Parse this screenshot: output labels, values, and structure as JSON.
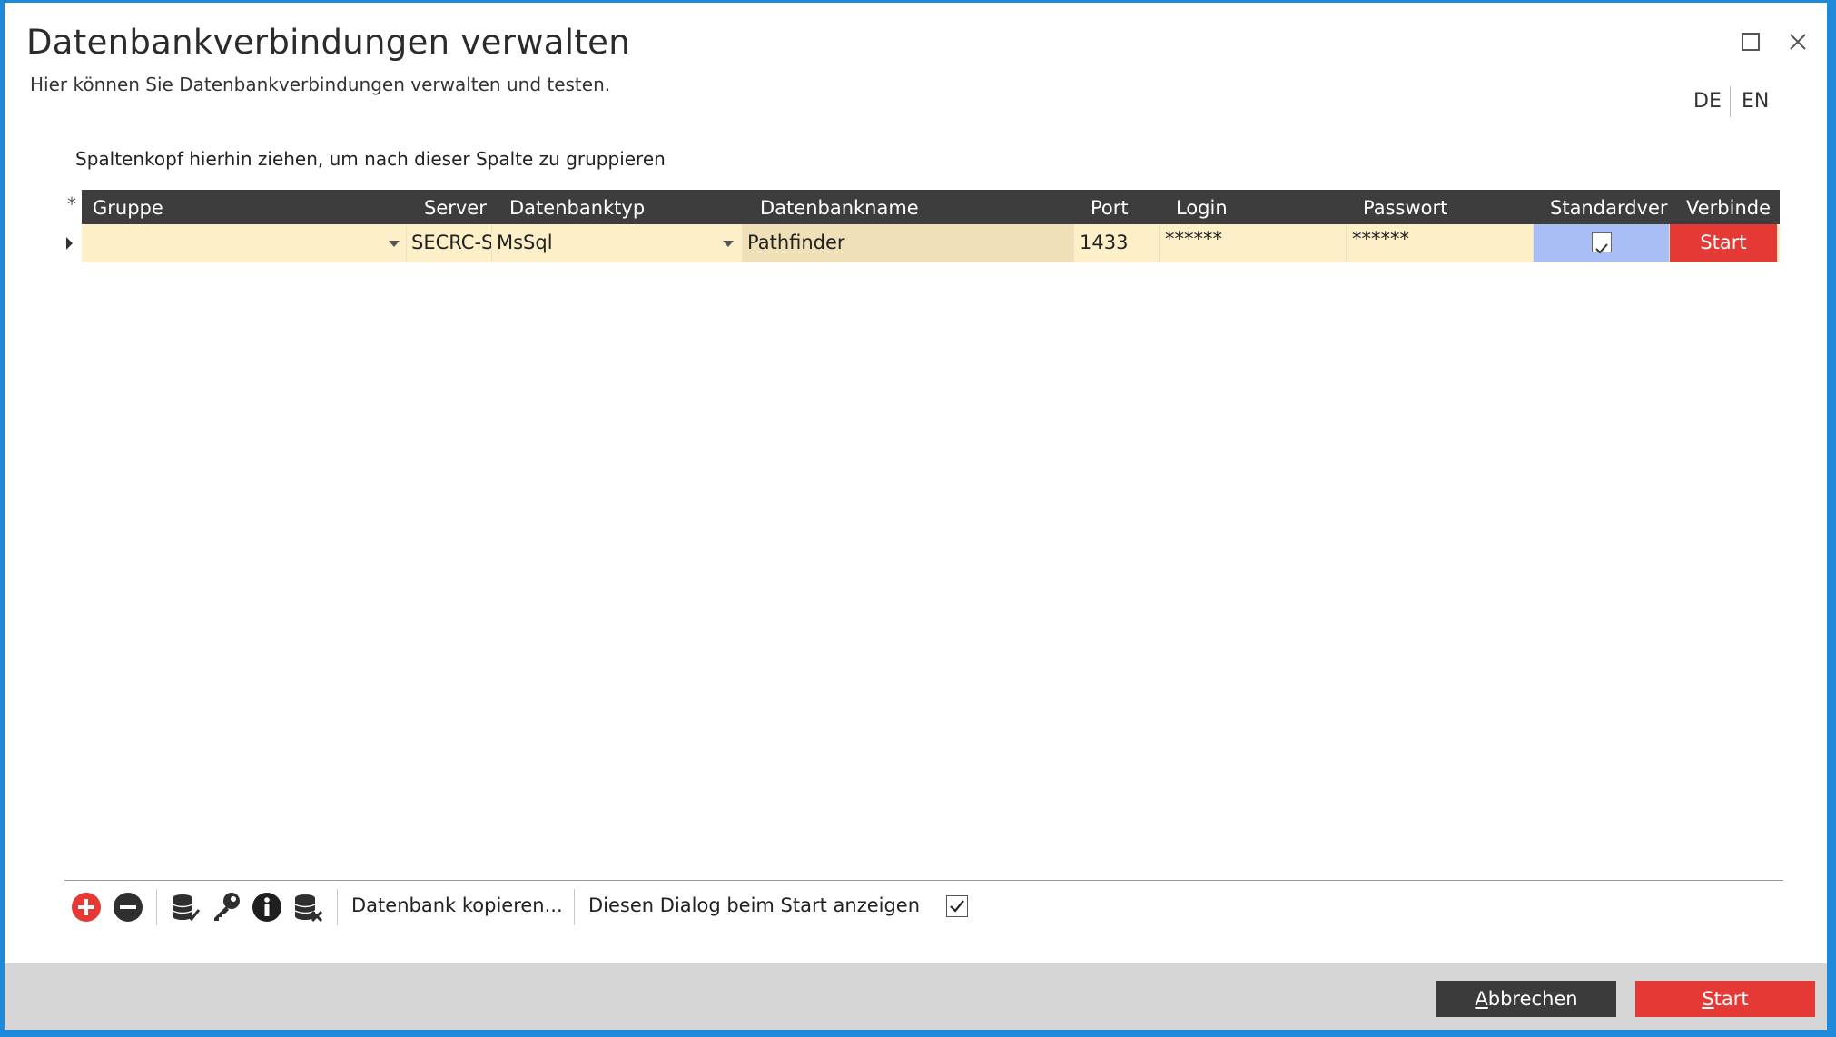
{
  "window": {
    "title": "Datenbankverbindungen verwalten",
    "subtitle": "Hier können Sie Datenbankverbindungen verwalten und testen.",
    "languages": [
      "DE",
      "EN"
    ]
  },
  "grid": {
    "group_hint": "Spaltenkopf hierhin ziehen, um nach dieser Spalte zu gruppieren",
    "new_row_symbol": "*",
    "columns": [
      "Gruppe",
      "Server",
      "Datenbanktyp",
      "Datenbankname",
      "Port",
      "Login",
      "Passwort",
      "Standardver",
      "Verbinde"
    ],
    "rows": [
      {
        "gruppe": "",
        "server": "SECRC-S",
        "datenbanktyp": "MsSql",
        "datenbankname": "Pathfinder",
        "port": "1433",
        "login": "******",
        "passwort": "******",
        "standard": true,
        "verbinden": "Start"
      }
    ]
  },
  "toolbar": {
    "icons": [
      "add-icon",
      "remove-icon",
      "database-check-icon",
      "key-icon",
      "info-icon",
      "database-delete-icon"
    ],
    "copy_db": "Datenbank kopieren...",
    "show_on_start": "Diesen Dialog beim Start anzeigen",
    "show_on_start_checked": true
  },
  "footer": {
    "cancel_access_key": "A",
    "cancel_rest": "bbrechen",
    "start_access_key": "S",
    "start_rest": "tart"
  },
  "colors": {
    "accent_red": "#e53935",
    "header_dark": "#3d3d3d",
    "row_highlight": "#fdf0c8",
    "check_cell": "#a8bef5",
    "window_border": "#1e88d9"
  }
}
